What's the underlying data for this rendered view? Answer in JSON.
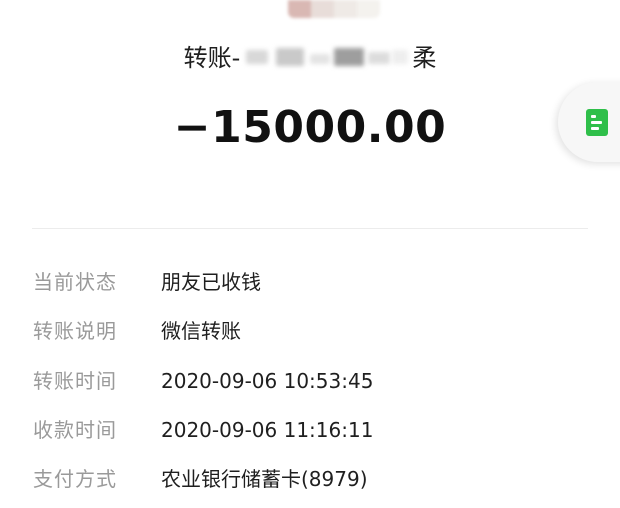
{
  "header": {
    "title_prefix": "转账-",
    "title_suffix": "柔",
    "amount": "−15000.00"
  },
  "details": [
    {
      "label": "当前状态",
      "value": "朋友已收钱"
    },
    {
      "label": "转账说明",
      "value": "微信转账"
    },
    {
      "label": "转账时间",
      "value": "2020-09-06 10:53:45"
    },
    {
      "label": "收款时间",
      "value": "2020-09-06 11:16:11"
    },
    {
      "label": "支付方式",
      "value": "农业银行储蓄卡(8979)"
    }
  ],
  "side_tab": {
    "icon": "receipt-document-icon",
    "icon_color": "#2fbf4a"
  },
  "colors": {
    "label": "#9a9a9a",
    "value": "#1f1f1f",
    "divider": "#ececec"
  }
}
